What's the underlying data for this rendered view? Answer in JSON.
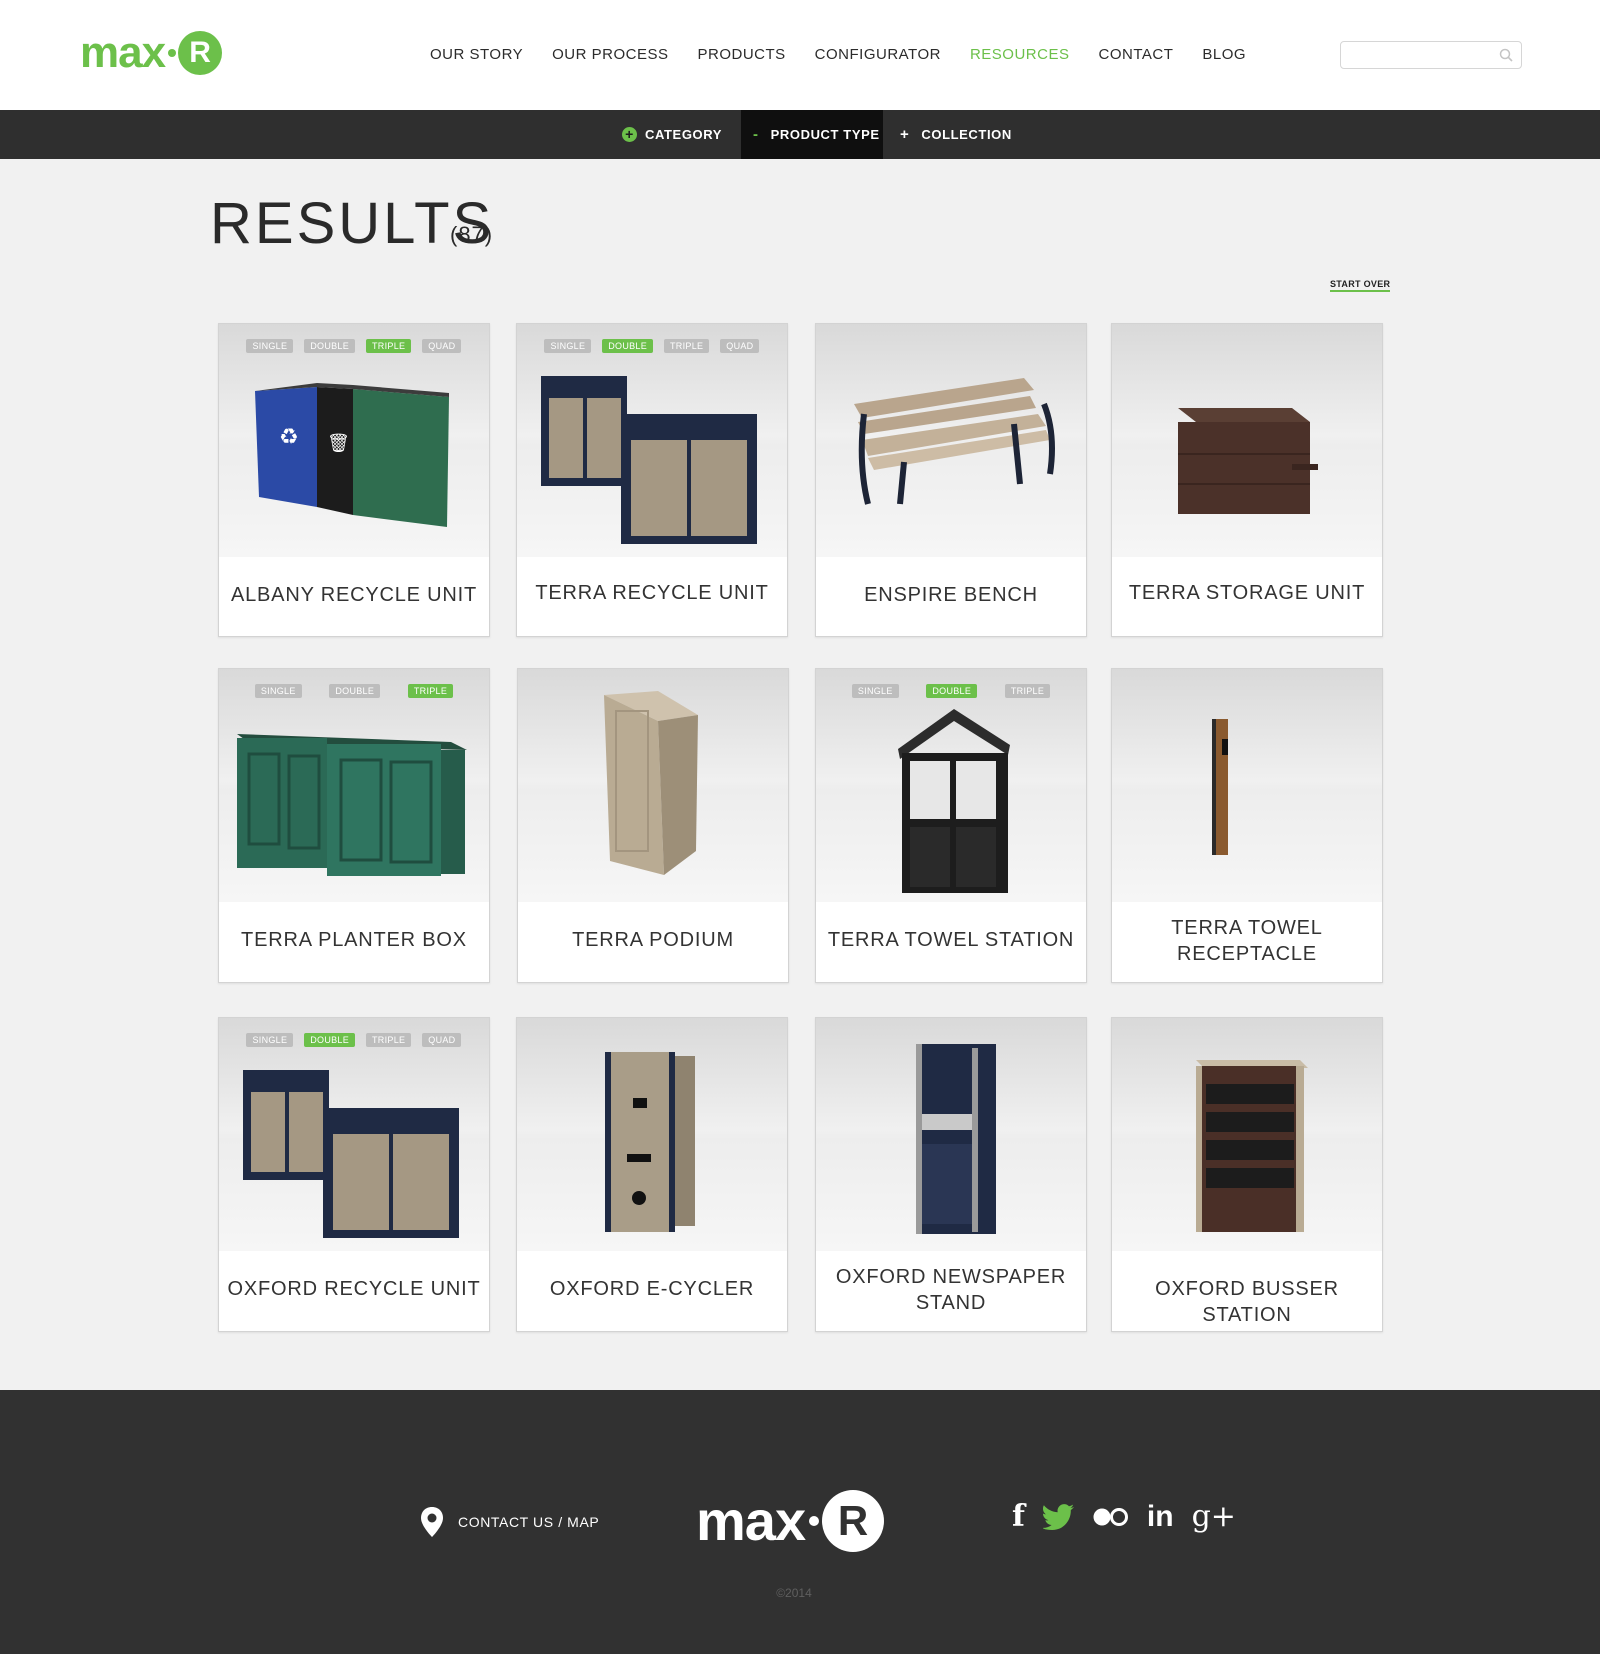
{
  "brand": {
    "logo_text": "max",
    "logo_letter": "R",
    "accent_color": "#6cc04a"
  },
  "nav": {
    "items": [
      {
        "label": "OUR STORY"
      },
      {
        "label": "OUR PROCESS"
      },
      {
        "label": "PRODUCTS"
      },
      {
        "label": "CONFIGURATOR"
      },
      {
        "label": "RESOURCES",
        "active": true
      },
      {
        "label": "CONTACT"
      },
      {
        "label": "BLOG"
      }
    ],
    "search_placeholder": ""
  },
  "filters": {
    "category": {
      "label": "CATEGORY",
      "symbol": "+"
    },
    "product_type": {
      "label": "PRODUCT TYPE",
      "symbol": "-"
    },
    "collection": {
      "label": "COLLECTION",
      "symbol": "+"
    }
  },
  "results": {
    "title": "RESULTS",
    "count": "(87)",
    "start_over": "START OVER"
  },
  "products": [
    {
      "name": "ALBANY RECYCLE UNIT",
      "tags": [
        "SINGLE",
        "DOUBLE",
        "TRIPLE",
        "QUAD"
      ],
      "selected_tag": "TRIPLE"
    },
    {
      "name": "TERRA RECYCLE UNIT",
      "tags": [
        "SINGLE",
        "DOUBLE",
        "TRIPLE",
        "QUAD"
      ],
      "selected_tag": "DOUBLE"
    },
    {
      "name": "ENSPIRE BENCH",
      "tags": [],
      "selected_tag": ""
    },
    {
      "name": "TERRA STORAGE UNIT",
      "tags": [],
      "selected_tag": ""
    },
    {
      "name": "TERRA PLANTER BOX",
      "tags": [
        "SINGLE",
        "DOUBLE",
        "TRIPLE"
      ],
      "selected_tag": "TRIPLE"
    },
    {
      "name": "TERRA PODIUM",
      "tags": [],
      "selected_tag": ""
    },
    {
      "name": "TERRA TOWEL STATION",
      "tags": [
        "SINGLE",
        "DOUBLE",
        "TRIPLE"
      ],
      "selected_tag": "DOUBLE"
    },
    {
      "name": "TERRA TOWEL RECEPTACLE",
      "tags": [],
      "selected_tag": ""
    },
    {
      "name": "OXFORD RECYCLE UNIT",
      "tags": [
        "SINGLE",
        "DOUBLE",
        "TRIPLE",
        "QUAD"
      ],
      "selected_tag": "DOUBLE"
    },
    {
      "name": "OXFORD E-CYCLER",
      "tags": [],
      "selected_tag": ""
    },
    {
      "name": "OXFORD NEWSPAPER STAND",
      "tags": [],
      "selected_tag": ""
    },
    {
      "name": "OXFORD BUSSER STATION",
      "tags": [],
      "selected_tag": ""
    }
  ],
  "footer": {
    "contact_label": "CONTACT US / MAP",
    "logo_text": "max",
    "logo_letter": "R",
    "social": [
      "facebook-icon",
      "twitter-icon",
      "flickr-icon",
      "linkedin-icon",
      "google-plus-icon"
    ],
    "social_glyphs": [
      "f",
      "",
      "",
      "in",
      "g+"
    ],
    "copyright": "©2014"
  }
}
